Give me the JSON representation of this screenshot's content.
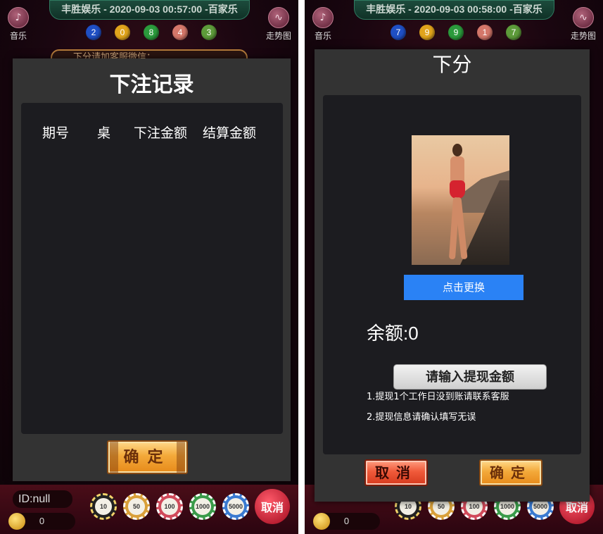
{
  "left": {
    "banner": "丰胜娱乐 - 2020-09-03 00:57:00 -百家乐",
    "balls": [
      {
        "n": "2",
        "color": "#1f4fc4"
      },
      {
        "n": "0",
        "color": "#e0a41c"
      },
      {
        "n": "8",
        "color": "#2b9b3c"
      },
      {
        "n": "4",
        "color": "#d4776a"
      },
      {
        "n": "3",
        "color": "#5d9b3a"
      }
    ],
    "music_label": "音乐",
    "trend_label": "走势图",
    "marquee": "下分请加客服微信：",
    "modal_title": "下注记录",
    "headers": [
      "期号",
      "桌",
      "下注金额",
      "结算金额"
    ],
    "confirm": "确定",
    "id_text": "ID:null",
    "coin_value": "0",
    "chips": [
      {
        "v": "10",
        "color": "#222"
      },
      {
        "v": "50",
        "color": "#d9a03a"
      },
      {
        "v": "100",
        "color": "#d04a5a"
      },
      {
        "v": "1000",
        "color": "#3a9b4a"
      },
      {
        "v": "5000",
        "color": "#3a7ad0"
      }
    ],
    "cancel": "取消"
  },
  "right": {
    "banner": "丰胜娱乐 - 2020-09-03 00:58:00 -百家乐",
    "balls": [
      {
        "n": "7",
        "color": "#1f4fc4"
      },
      {
        "n": "9",
        "color": "#e0a41c"
      },
      {
        "n": "9",
        "color": "#2b9b3c"
      },
      {
        "n": "1",
        "color": "#d4776a"
      },
      {
        "n": "7",
        "color": "#5d9b3a"
      }
    ],
    "music_label": "音乐",
    "trend_label": "走势图",
    "modal_title": "下分",
    "change_button": "点击更换",
    "balance": "余额:0",
    "amount_placeholder": "请输入提现金额",
    "notes": [
      "1.提现1个工作日没到账请联系客服",
      "2.提现信息请确认填写无误"
    ],
    "cancel": "取消",
    "confirm": "确定",
    "coin_value": "0",
    "chips": [
      "10",
      "50",
      "100",
      "1000",
      "5000"
    ],
    "cancel_circle": "取消"
  }
}
